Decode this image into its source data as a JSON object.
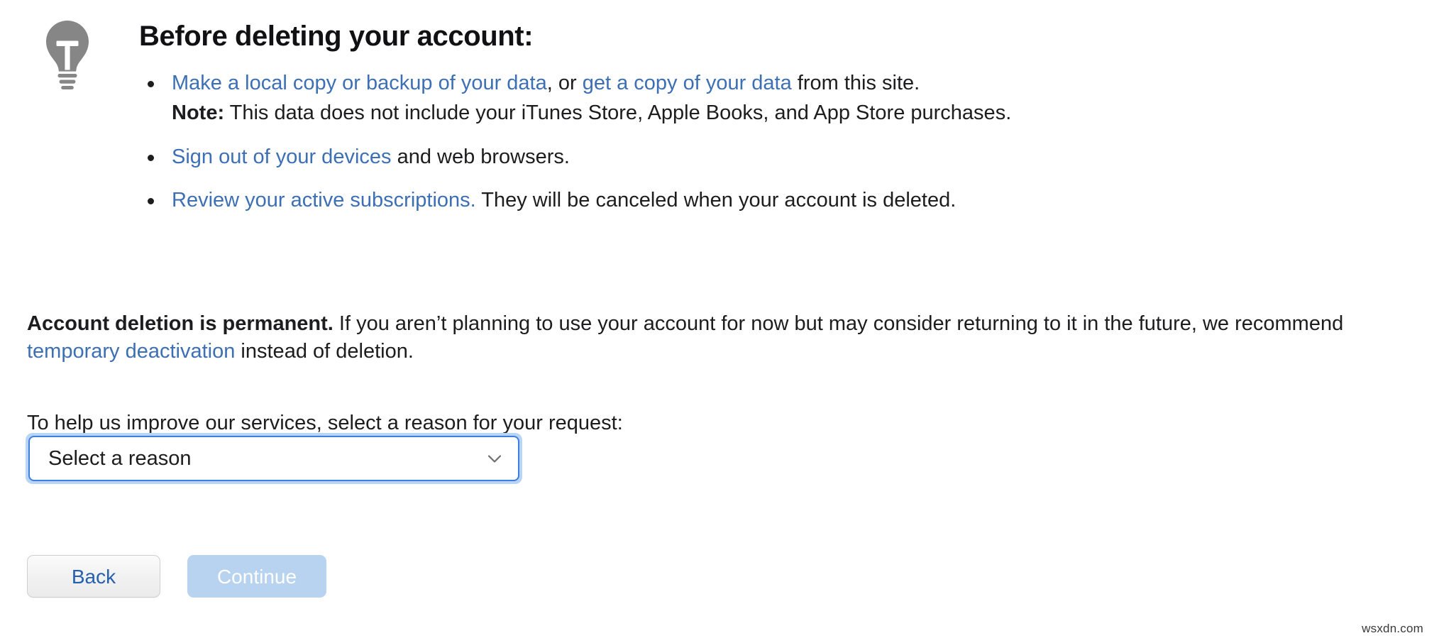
{
  "notice": {
    "icon": "lightbulb-icon",
    "heading": "Before deleting your account:",
    "bullets": [
      {
        "link1": "Make a local copy or backup of your data",
        "mid": ", or ",
        "link2": "get a copy of your data",
        "tail": " from this site.",
        "note_label": "Note:",
        "note_text": " This data does not include your iTunes Store, Apple Books, and App Store purchases."
      },
      {
        "link1": "Sign out of your devices",
        "tail": " and web browsers."
      },
      {
        "link1": "Review your active subscriptions.",
        "tail": " They will be canceled when your account is deleted."
      }
    ]
  },
  "body": {
    "permanent_lead": "Account deletion is permanent.",
    "permanent_text": " If you aren’t planning to use your account for now but may consider returning to it in the future, we recommend ",
    "permanent_link": "temporary deactivation",
    "permanent_tail": " instead of deletion.",
    "reason_prompt": "To help us improve our services, select a reason for your request:"
  },
  "reason_select": {
    "value": "Select a reason",
    "placeholder": "Select a reason",
    "chevron": "chevron-down-icon",
    "focused": true
  },
  "actions": {
    "back_label": "Back",
    "continue_label": "Continue",
    "continue_disabled": true
  },
  "watermark": {
    "text": "wsxdn.com"
  },
  "colors": {
    "link_blue": "#3d6fb4",
    "focus_ring": "#b9d4f4",
    "select_border": "#3b7fe0",
    "back_text": "#2560ae",
    "continue_bg": "#b8d3f0",
    "icon_gray": "#868686",
    "text": "#1d1d1f"
  }
}
